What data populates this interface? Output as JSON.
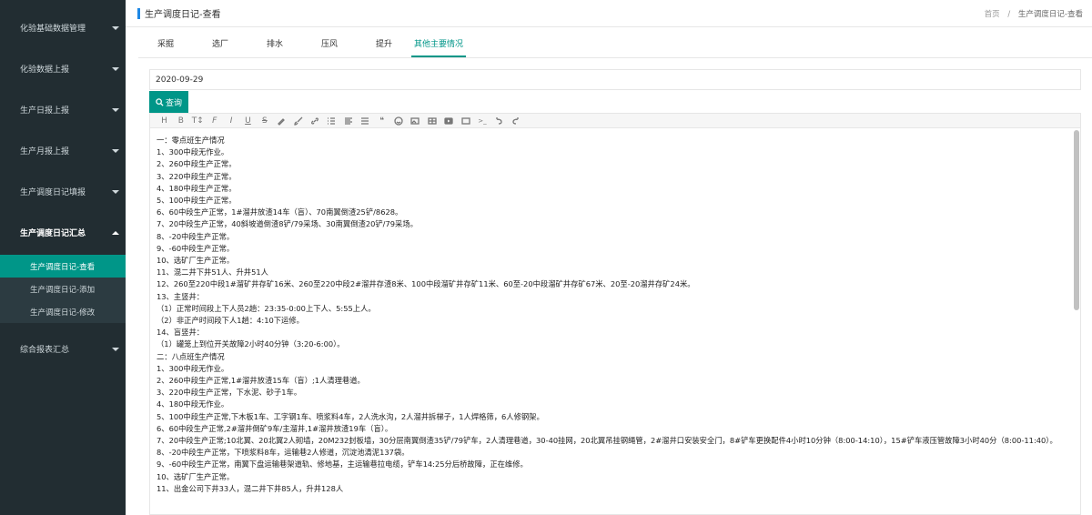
{
  "sidebar": {
    "items": [
      {
        "label": "化验基础数据管理",
        "active": false
      },
      {
        "label": "化验数据上报",
        "active": false
      },
      {
        "label": "生产日报上报",
        "active": false
      },
      {
        "label": "生产月报上报",
        "active": false
      },
      {
        "label": "生产调度日记填报",
        "active": false
      },
      {
        "label": "生产调度日记汇总",
        "active": true
      }
    ],
    "subitems": [
      {
        "label": "生产调度日记-查看",
        "current": true
      },
      {
        "label": "生产调度日记-添加",
        "current": false
      },
      {
        "label": "生产调度日记-修改",
        "current": false
      }
    ],
    "last_item": {
      "label": "综合报表汇总"
    }
  },
  "header": {
    "title": "生产调度日记-查看",
    "breadcrumb": {
      "home": "首页",
      "separator": "/",
      "current": "生产调度日记-查看"
    }
  },
  "tabs": [
    {
      "label": "采掘",
      "active": false
    },
    {
      "label": "选厂",
      "active": false
    },
    {
      "label": "排水",
      "active": false
    },
    {
      "label": "压风",
      "active": false
    },
    {
      "label": "提升",
      "active": false
    },
    {
      "label": "其他主要情况",
      "active": true
    }
  ],
  "search": {
    "date_value": "2020-09-29",
    "query_label": "查询"
  },
  "toolbar_icons": [
    "heading-icon",
    "bold-icon",
    "text-size-icon",
    "font-icon",
    "italic-icon",
    "underline-icon",
    "strikethrough-icon",
    "highlighter-icon",
    "brush-icon",
    "link-icon",
    "list-icon",
    "align-icon",
    "table-grid-icon",
    "quote-icon",
    "emoji-icon",
    "image-icon",
    "table-icon",
    "video-icon",
    "code-block-icon",
    "terminal-icon",
    "undo-icon",
    "redo-icon"
  ],
  "toolbar_text": {
    "heading": "H",
    "bold": "B",
    "text_size": "T↕",
    "font": "F",
    "italic": "I",
    "underline": "U",
    "strikethrough": "S",
    "quote": "❝",
    "terminal": ">_"
  },
  "content_lines": [
    "一：零点班生产情况",
    "1、300中段无作业。",
    "2、260中段生产正常。",
    "3、220中段生产正常。",
    "4、180中段生产正常。",
    "5、100中段生产正常。",
    "6、60中段生产正常，1#溜井放渣14车（盲）、70南翼倒渣25铲/8628。",
    "7、20中段生产正常，40斜坡道倒渣8铲/79采场、30南翼倒渣20铲/79采场。",
    "8、-20中段生产正常。",
    "9、-60中段生产正常。",
    "10、选矿厂生产正常。",
    "11、混二井下井51人、升井51人",
    "12、260至220中段1#溜矿井存矿16米、260至220中段2#溜井存渣8米、100中段溜矿井存矿11米、60至-20中段溜矿井存矿67米、20至-20溜井存矿24米。",
    "13、主竖井：",
    "（1）正常时间段上下人员2趟：23:35-0:00上下人、5:55上人。",
    "（2）非正产时间段下人1趟：4:10下运修。",
    "14、盲竖井：",
    "（1）罐笼上到位开关故障2小时40分钟（3:20-6:00）。",
    "二：八点班生产情况",
    "1、300中段无作业。",
    "2、260中段生产正常,1#溜井放渣15车（盲）;1人清理巷道。",
    "3、220中段生产正常，下水泥、砂子1车。",
    "4、180中段无作业。",
    "5、100中段生产正常,下木板1车、工字钢1车、喷浆料4车，2人洗水沟，2人溜井拆梯子，1人焊格筛，6人修钢架。",
    "6、60中段生产正常,2#溜井倒矿9车/主溜井,1#溜井放渣19车（盲）。",
    "7、20中段生产正常;10北翼、20北翼2人砌墙，20M232封板墙，30分层南翼倒渣35铲/79铲车，2人清理巷道，30-40挂网，20北翼吊挂钢绳管，2#溜井口安装安全门，8#铲车更换配件4小时10分钟（8:00-14:10），15#铲车液压管故障3小时40分（8:00-11:40）。",
    "8、-20中段生产正常，下喷浆料8车，运输巷2人修道，沉淀池清泥137袋。",
    "9、-60中段生产正常，南翼下盘运输巷架道轨、修地基，主运输巷拉电缆，铲车14:25分后桥故障，正在维修。",
    "10、选矿厂生产正常。",
    "11、出金公司下井33人，混二井下井85人，升井128人"
  ]
}
